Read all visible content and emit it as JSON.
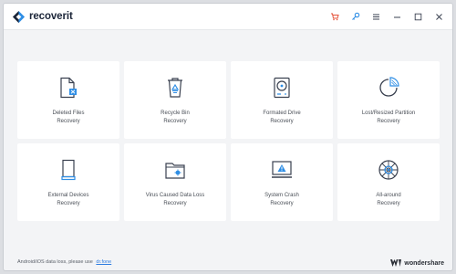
{
  "app": {
    "logo_text": "recoverit"
  },
  "titlebar": {
    "buttons": [
      "cart-icon",
      "key-icon",
      "menu-icon",
      "minimize-icon",
      "maximize-icon",
      "close-icon"
    ]
  },
  "cards": [
    {
      "line1": "Deleted Files",
      "line2": "Recovery",
      "icon": "deleted-files-icon"
    },
    {
      "line1": "Recycle Bin",
      "line2": "Recovery",
      "icon": "recycle-bin-icon"
    },
    {
      "line1": "Formated Drive",
      "line2": "Recovery",
      "icon": "formatted-drive-icon"
    },
    {
      "line1": "Lost/Resized Partition",
      "line2": "Recovery",
      "icon": "partition-icon"
    },
    {
      "line1": "External Devices",
      "line2": "Recovery",
      "icon": "external-device-icon"
    },
    {
      "line1": "Virus Caused Data Loss",
      "line2": "Recovery",
      "icon": "virus-folder-icon"
    },
    {
      "line1": "System Crash",
      "line2": "Recovery",
      "icon": "system-crash-icon"
    },
    {
      "line1": "All-around",
      "line2": "Recovery",
      "icon": "all-around-icon"
    }
  ],
  "footer": {
    "text": "Android/iOS data loss, please use",
    "link": "dr.fone",
    "brand": "wondershare"
  },
  "colors": {
    "accent_blue": "#2f8ee5",
    "icon_dark": "#3a4150",
    "cart_red": "#e5533a"
  }
}
